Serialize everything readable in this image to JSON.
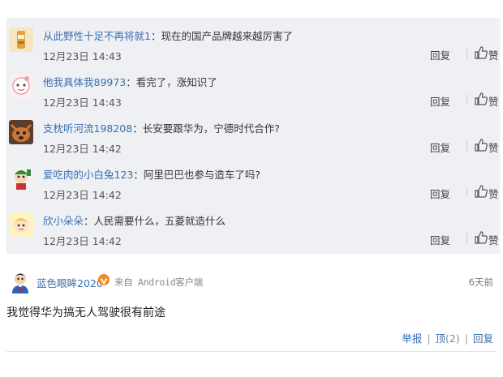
{
  "replies": [
    {
      "user": "从此野性十足不再将就1",
      "colon": "：",
      "text": "现在的国产品牌越来越厉害了",
      "time": "12月23日 14:43",
      "reply_label": "回复",
      "like_label": "赞"
    },
    {
      "user": "他我具体我89973",
      "colon": "：",
      "text": "看完了，涨知识了",
      "time": "12月23日 14:43",
      "reply_label": "回复",
      "like_label": "赞"
    },
    {
      "user": "支枕听河流198208",
      "colon": "：",
      "text": "长安要跟华为，宁德时代合作?",
      "time": "12月23日 14:42",
      "reply_label": "回复",
      "like_label": "赞"
    },
    {
      "user": "爱吃肉的小白兔123",
      "colon": "：",
      "text": "阿里巴巴也参与造车了吗?",
      "time": "12月23日 14:42",
      "reply_label": "回复",
      "like_label": "赞"
    },
    {
      "user": "欣小朵朵",
      "colon": "：",
      "text": "人民需要什么，五菱就造什么",
      "time": "12月23日 14:42",
      "reply_label": "回复",
      "like_label": "赞"
    }
  ],
  "comment": {
    "user": "蓝色眼眸2020",
    "source": "来自 Android客户端",
    "time": "6天前",
    "content": "我觉得华为搞无人驾驶很有前途",
    "report_label": "举报",
    "upvote_label": "顶",
    "upvote_count": "(2)",
    "reply_label": "回复",
    "divider": "|"
  }
}
